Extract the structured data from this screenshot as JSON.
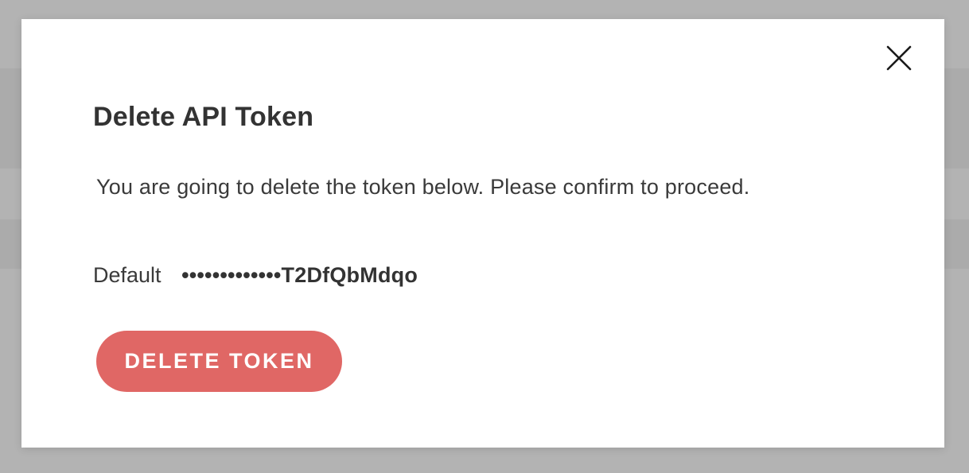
{
  "dialog": {
    "title": "Delete API Token",
    "message": "You are going to delete the token below. Please confirm to proceed.",
    "token": {
      "name": "Default",
      "masked_value": "•••••••••••••T2DfQbMdqo"
    },
    "delete_button_label": "DELETE TOKEN",
    "close_icon": "close-icon"
  },
  "colors": {
    "overlay": "#b3b3b3",
    "modal_background": "#ffffff",
    "danger_button": "#e06765",
    "text_primary": "#333333"
  }
}
